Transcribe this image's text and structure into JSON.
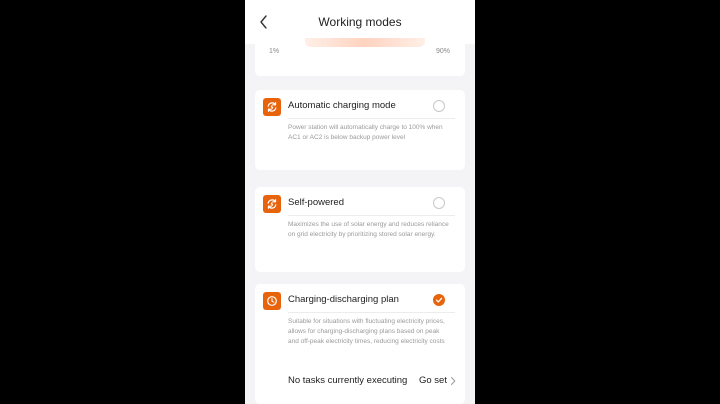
{
  "header": {
    "title": "Working modes"
  },
  "slider": {
    "min_label": "1%",
    "max_label": "90%"
  },
  "modes": [
    {
      "title": "Automatic charging mode",
      "description": "Power station will automatically charge to 100% when AC1 or AC2 is below backup power level",
      "icon": "cycle-icon",
      "selected": false
    },
    {
      "title": "Self-powered",
      "description": "Maximizes the use of solar energy and reduces reliance on grid electricity by prioritizing stored solar energy.",
      "icon": "cycle-icon",
      "selected": false
    },
    {
      "title": "Charging-discharging plan",
      "description": "Suitable for situations with fluctuating electricity prices, allows for charging-discharging plans based on peak and off-peak electricity times, reducing electricity costs",
      "icon": "clock-icon",
      "selected": true
    }
  ],
  "plan": {
    "task_status": "No tasks currently executing",
    "go_set_label": "Go set"
  },
  "colors": {
    "accent": "#e8640c",
    "background": "#f4f4f6",
    "card": "#ffffff"
  }
}
